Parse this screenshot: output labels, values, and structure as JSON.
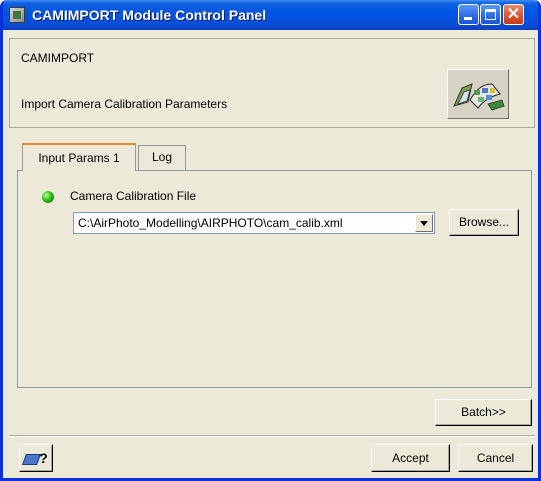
{
  "window": {
    "title": "CAMIMPORT Module Control Panel",
    "icon": "app-window-icon"
  },
  "header": {
    "module_name": "CAMIMPORT",
    "module_description": "Import Camera Calibration Parameters",
    "logo_icon": "camera-film-icon"
  },
  "tabs": [
    {
      "label": "Input Params 1",
      "active": true
    },
    {
      "label": "Log",
      "active": false
    }
  ],
  "input_params": {
    "status_color": "#2fbf1a",
    "field_label": "Camera Calibration File",
    "file_path": "C:\\AirPhoto_Modelling\\AIRPHOTO\\cam_calib.xml",
    "browse_label": "Browse..."
  },
  "buttons": {
    "batch": "Batch>>",
    "help": "?",
    "accept": "Accept",
    "cancel": "Cancel"
  }
}
